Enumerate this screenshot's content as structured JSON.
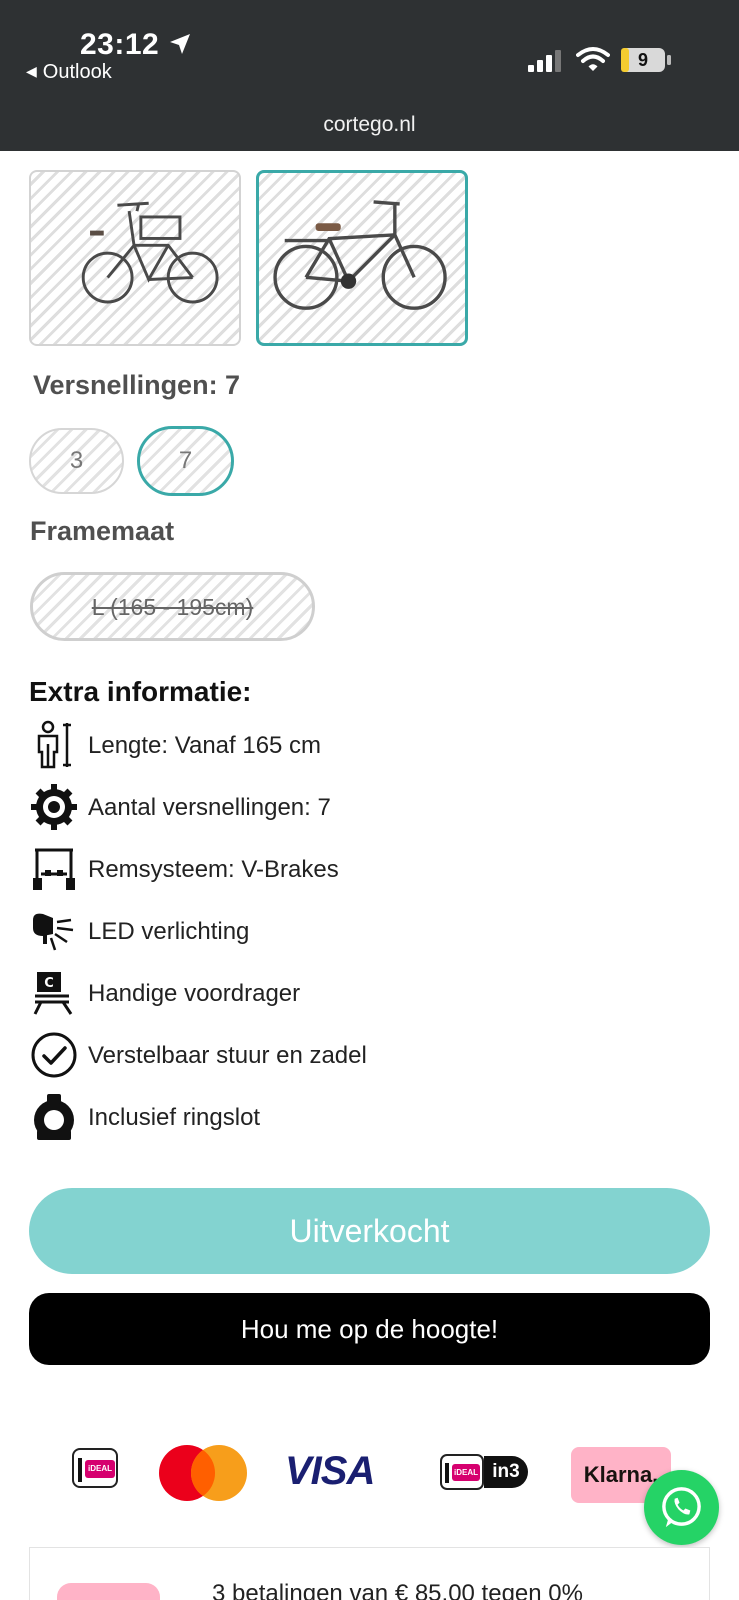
{
  "status_bar": {
    "time": "23:12",
    "back_app": "Outlook",
    "battery": "9",
    "icons": [
      "location-arrow-icon",
      "signal-icon",
      "wifi-icon",
      "battery-icon"
    ]
  },
  "browser": {
    "url": "cortego.nl"
  },
  "product": {
    "variants": [
      {
        "name": "lady-bike",
        "selected": false
      },
      {
        "name": "men-bike",
        "selected": true
      }
    ],
    "gears": {
      "label": "Versnellingen: 7",
      "options": [
        {
          "label": "3",
          "selected": false
        },
        {
          "label": "7",
          "selected": true
        }
      ]
    },
    "frame": {
      "label": "Framemaat",
      "options": [
        {
          "label": "L (165 - 195cm)",
          "available": false
        }
      ]
    }
  },
  "extra_info": {
    "title": "Extra informatie:",
    "items": [
      {
        "icon": "height-icon",
        "text": "Lengte: Vanaf 165 cm"
      },
      {
        "icon": "gear-icon",
        "text": "Aantal versnellingen: 7"
      },
      {
        "icon": "brake-icon",
        "text": "Remsysteem: V-Brakes"
      },
      {
        "icon": "bike-light-icon",
        "text": "LED verlichting"
      },
      {
        "icon": "front-carrier-icon",
        "text": "Handige voordrager"
      },
      {
        "icon": "check-circle-icon",
        "text": "Verstelbaar stuur en zadel"
      },
      {
        "icon": "ring-lock-icon",
        "text": "Inclusief ringslot"
      }
    ]
  },
  "actions": {
    "sold_out_label": "Uitverkocht",
    "notify_label": "Hou me op de hoogte!"
  },
  "payment": {
    "ideal_text": "iDEAL",
    "visa_text": "VISA",
    "in3_text": "in3",
    "klarna_text": "Klarna."
  },
  "klarna_banner": {
    "text": "3 betalingen van € 85,00 tegen 0%"
  },
  "colors": {
    "accent": "#3aa9a8",
    "sold_out": "#83d3d0",
    "klarna_pink": "#ffb3c7",
    "whatsapp": "#25d366"
  }
}
